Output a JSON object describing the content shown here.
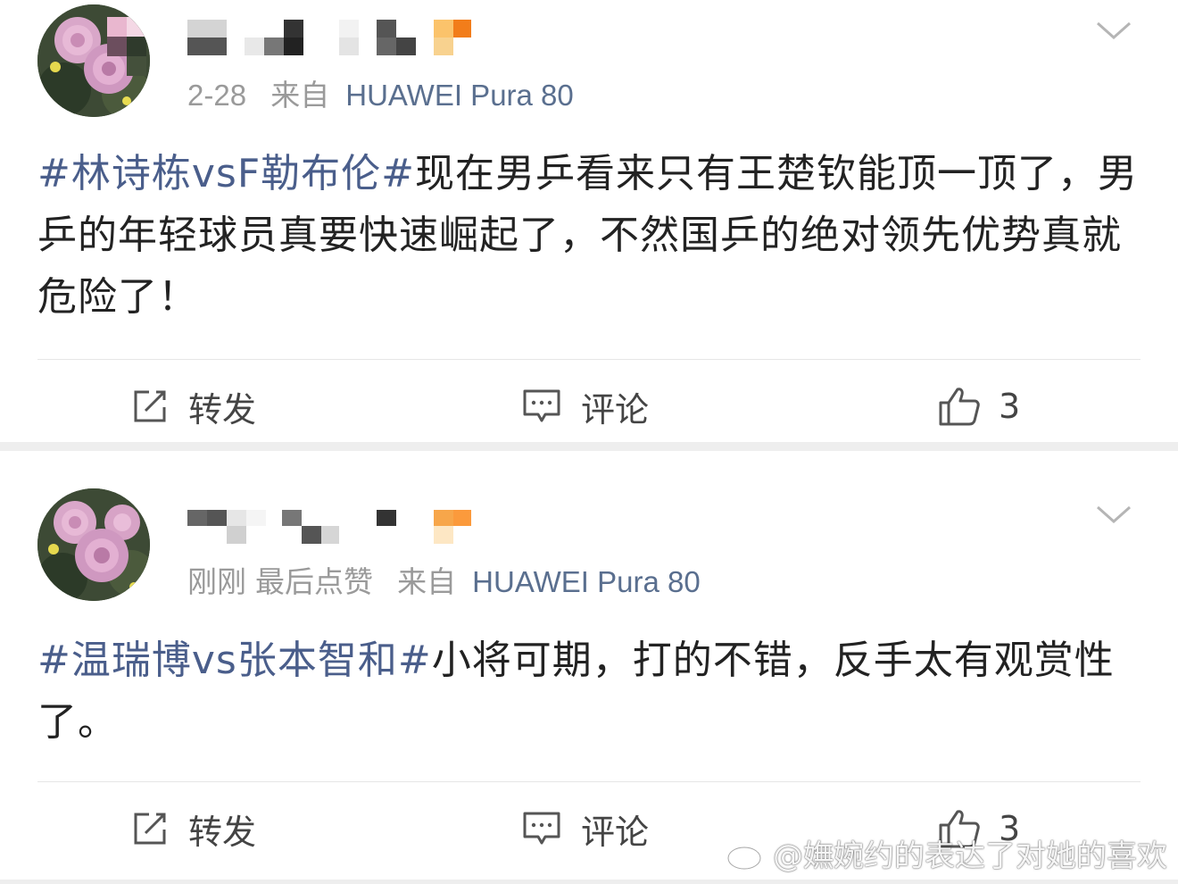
{
  "posts": [
    {
      "time": "2-28",
      "liked_note": "",
      "source": "来自",
      "device": "HUAWEI Pura 80",
      "content": {
        "tag": "#林诗栋vsF勒布伦#",
        "text": "现在男乒看来只有王楚钦能顶一顶了，男乒的年轻球员真要快速崛起了，不然国乒的绝对领先优势真就危险了！"
      },
      "actions": {
        "repost": "转发",
        "comment": "评论",
        "like_count": "3"
      }
    },
    {
      "time": "刚刚",
      "liked_note": "最后点赞",
      "source": "来自",
      "device": "HUAWEI Pura 80",
      "content": {
        "tag": "#温瑞博vs张本智和#",
        "text": "小将可期，打的不错，反手太有观赏性了。"
      },
      "actions": {
        "repost": "转发",
        "comment": "评论",
        "like_count": "3"
      }
    }
  ],
  "watermark": "@嫵婉约的表达了对她的喜欢",
  "icons": {
    "avatar": "chrysanthemum-avatar-icon",
    "name": "pixelated-username",
    "menu": "chevron-down-icon",
    "repost": "repost-edit-icon",
    "comment": "comment-bubble-icon",
    "like": "thumbs-up-icon",
    "watermark_logo": "weibo-logo-icon"
  },
  "colors": {
    "topic_tag": "#4a5e8b",
    "device_link": "#5a6f8f",
    "meta_gray": "#9a9a9a",
    "body_text": "#222222",
    "section_gap": "#eeeeee"
  }
}
